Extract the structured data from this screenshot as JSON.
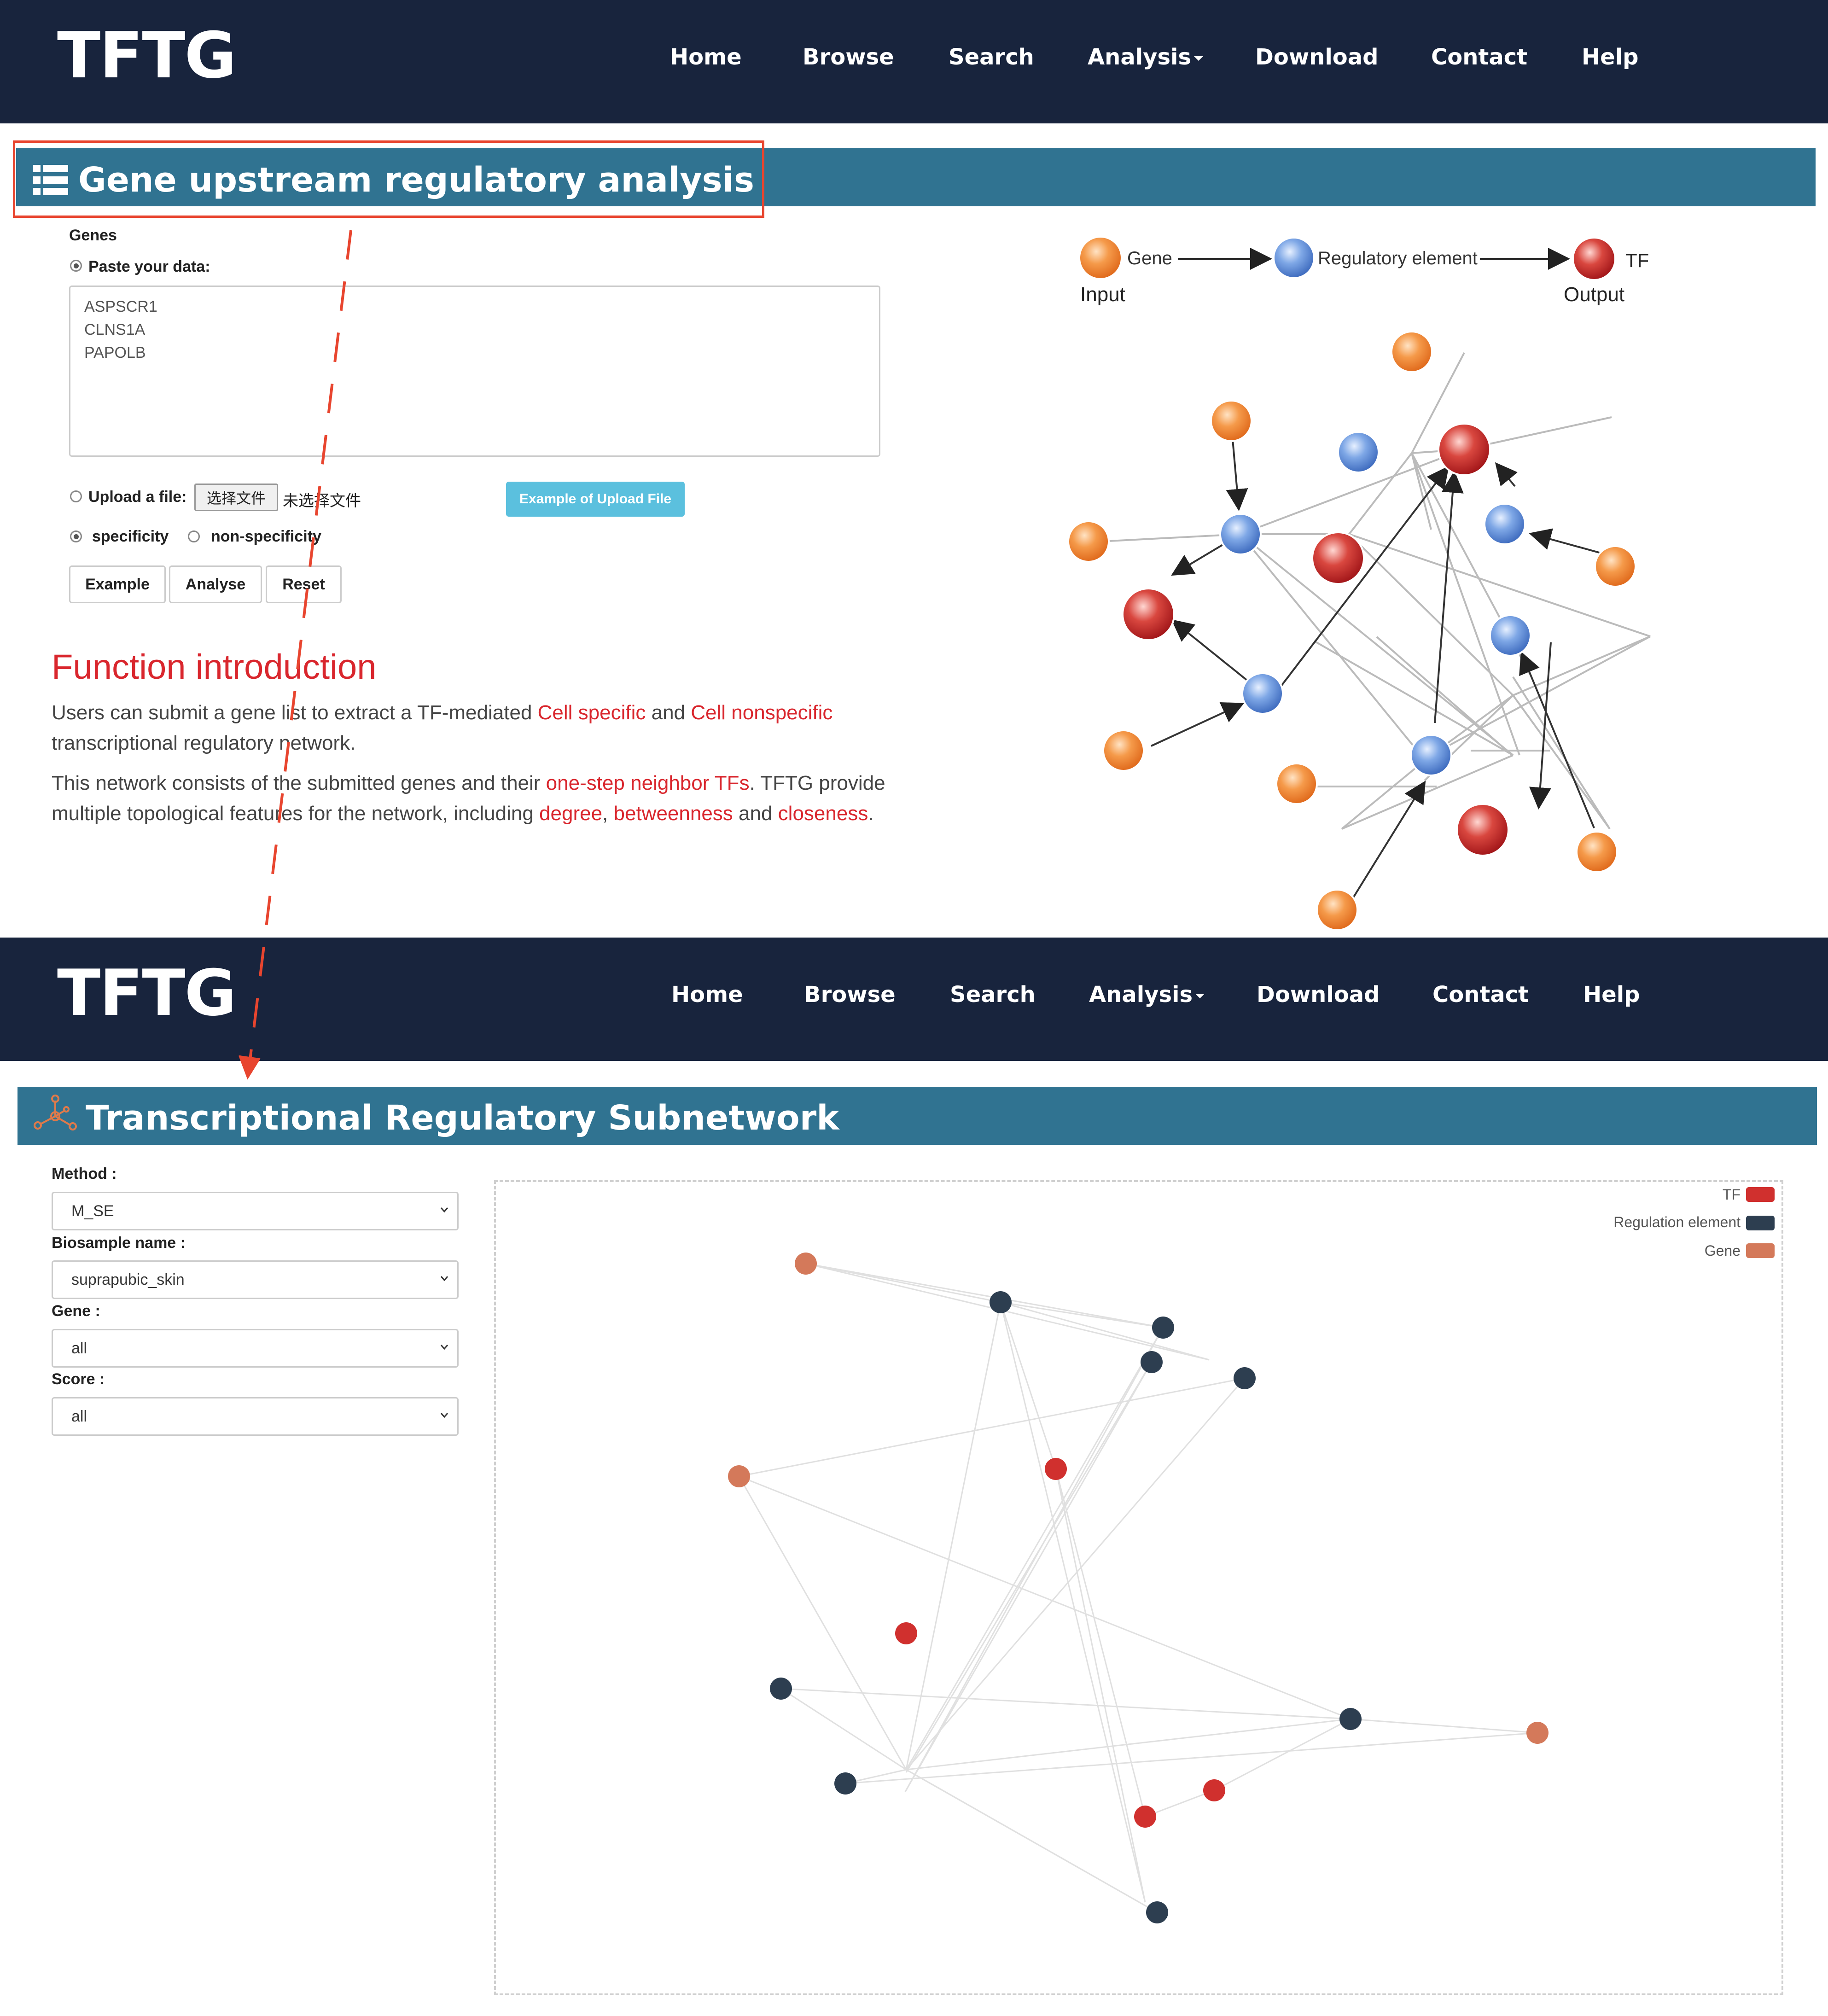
{
  "navbar": {
    "logo": "TFTG",
    "items": [
      "Home",
      "Browse",
      "Search",
      "Analysis",
      "Download",
      "Contact",
      "Help"
    ]
  },
  "analysis": {
    "title": "Gene upstream regulatory analysis",
    "genes_label": "Genes",
    "paste_label": "Paste your data:",
    "textarea_value": "ASPSCR1\nCLNS1A\nPAPOLB",
    "upload_label": "Upload a file:",
    "file_button": "选择文件",
    "no_file": "未选择文件",
    "example_upload_button": "Example of Upload File",
    "specificity": "specificity",
    "non_specificity": "non-specificity",
    "buttons": {
      "example": "Example",
      "analyse": "Analyse",
      "reset": "Reset"
    },
    "function_title": "Function introduction",
    "para1": {
      "t1": "Users can submit a gene list to extract a TF-mediated ",
      "r1": "Cell specific",
      "t2": " and ",
      "r2": "Cell nonspecific",
      "t3": " transcriptional regulatory network."
    },
    "para2": {
      "t1": "This network consists of the submitted genes and their ",
      "r1": "one-step neighbor TFs",
      "t2": ". TFTG provide multiple topological features for the network, including ",
      "r2": "degree",
      "t3": ", ",
      "r3": "betweenness",
      "t4": " and ",
      "r4": "closeness",
      "t5": "."
    },
    "diagram": {
      "gene_label": "Gene",
      "reg_label": "Regulatory element",
      "tf_label": "TF",
      "input_label": "Input",
      "output_label": "Output",
      "colors": {
        "gene": "#f0883a",
        "reg": "#5b8fd6",
        "tf": "#d0302e"
      }
    }
  },
  "subnetwork": {
    "title": "Transcriptional Regulatory Subnetwork",
    "filters": [
      {
        "label": "Method :",
        "value": "M_SE"
      },
      {
        "label": "Biosample name :",
        "value": "suprapubic_skin"
      },
      {
        "label": "Gene :",
        "value": "all"
      },
      {
        "label": "Score :",
        "value": "all"
      }
    ],
    "legend": [
      {
        "label": "TF",
        "color": "#d0302e"
      },
      {
        "label": "Regulation element",
        "color": "#2d3e50"
      },
      {
        "label": "Gene",
        "color": "#d4795a"
      }
    ]
  },
  "colors": {
    "navbar": "#18243d",
    "section_bar": "#307391",
    "accent_red": "#d9262d"
  }
}
